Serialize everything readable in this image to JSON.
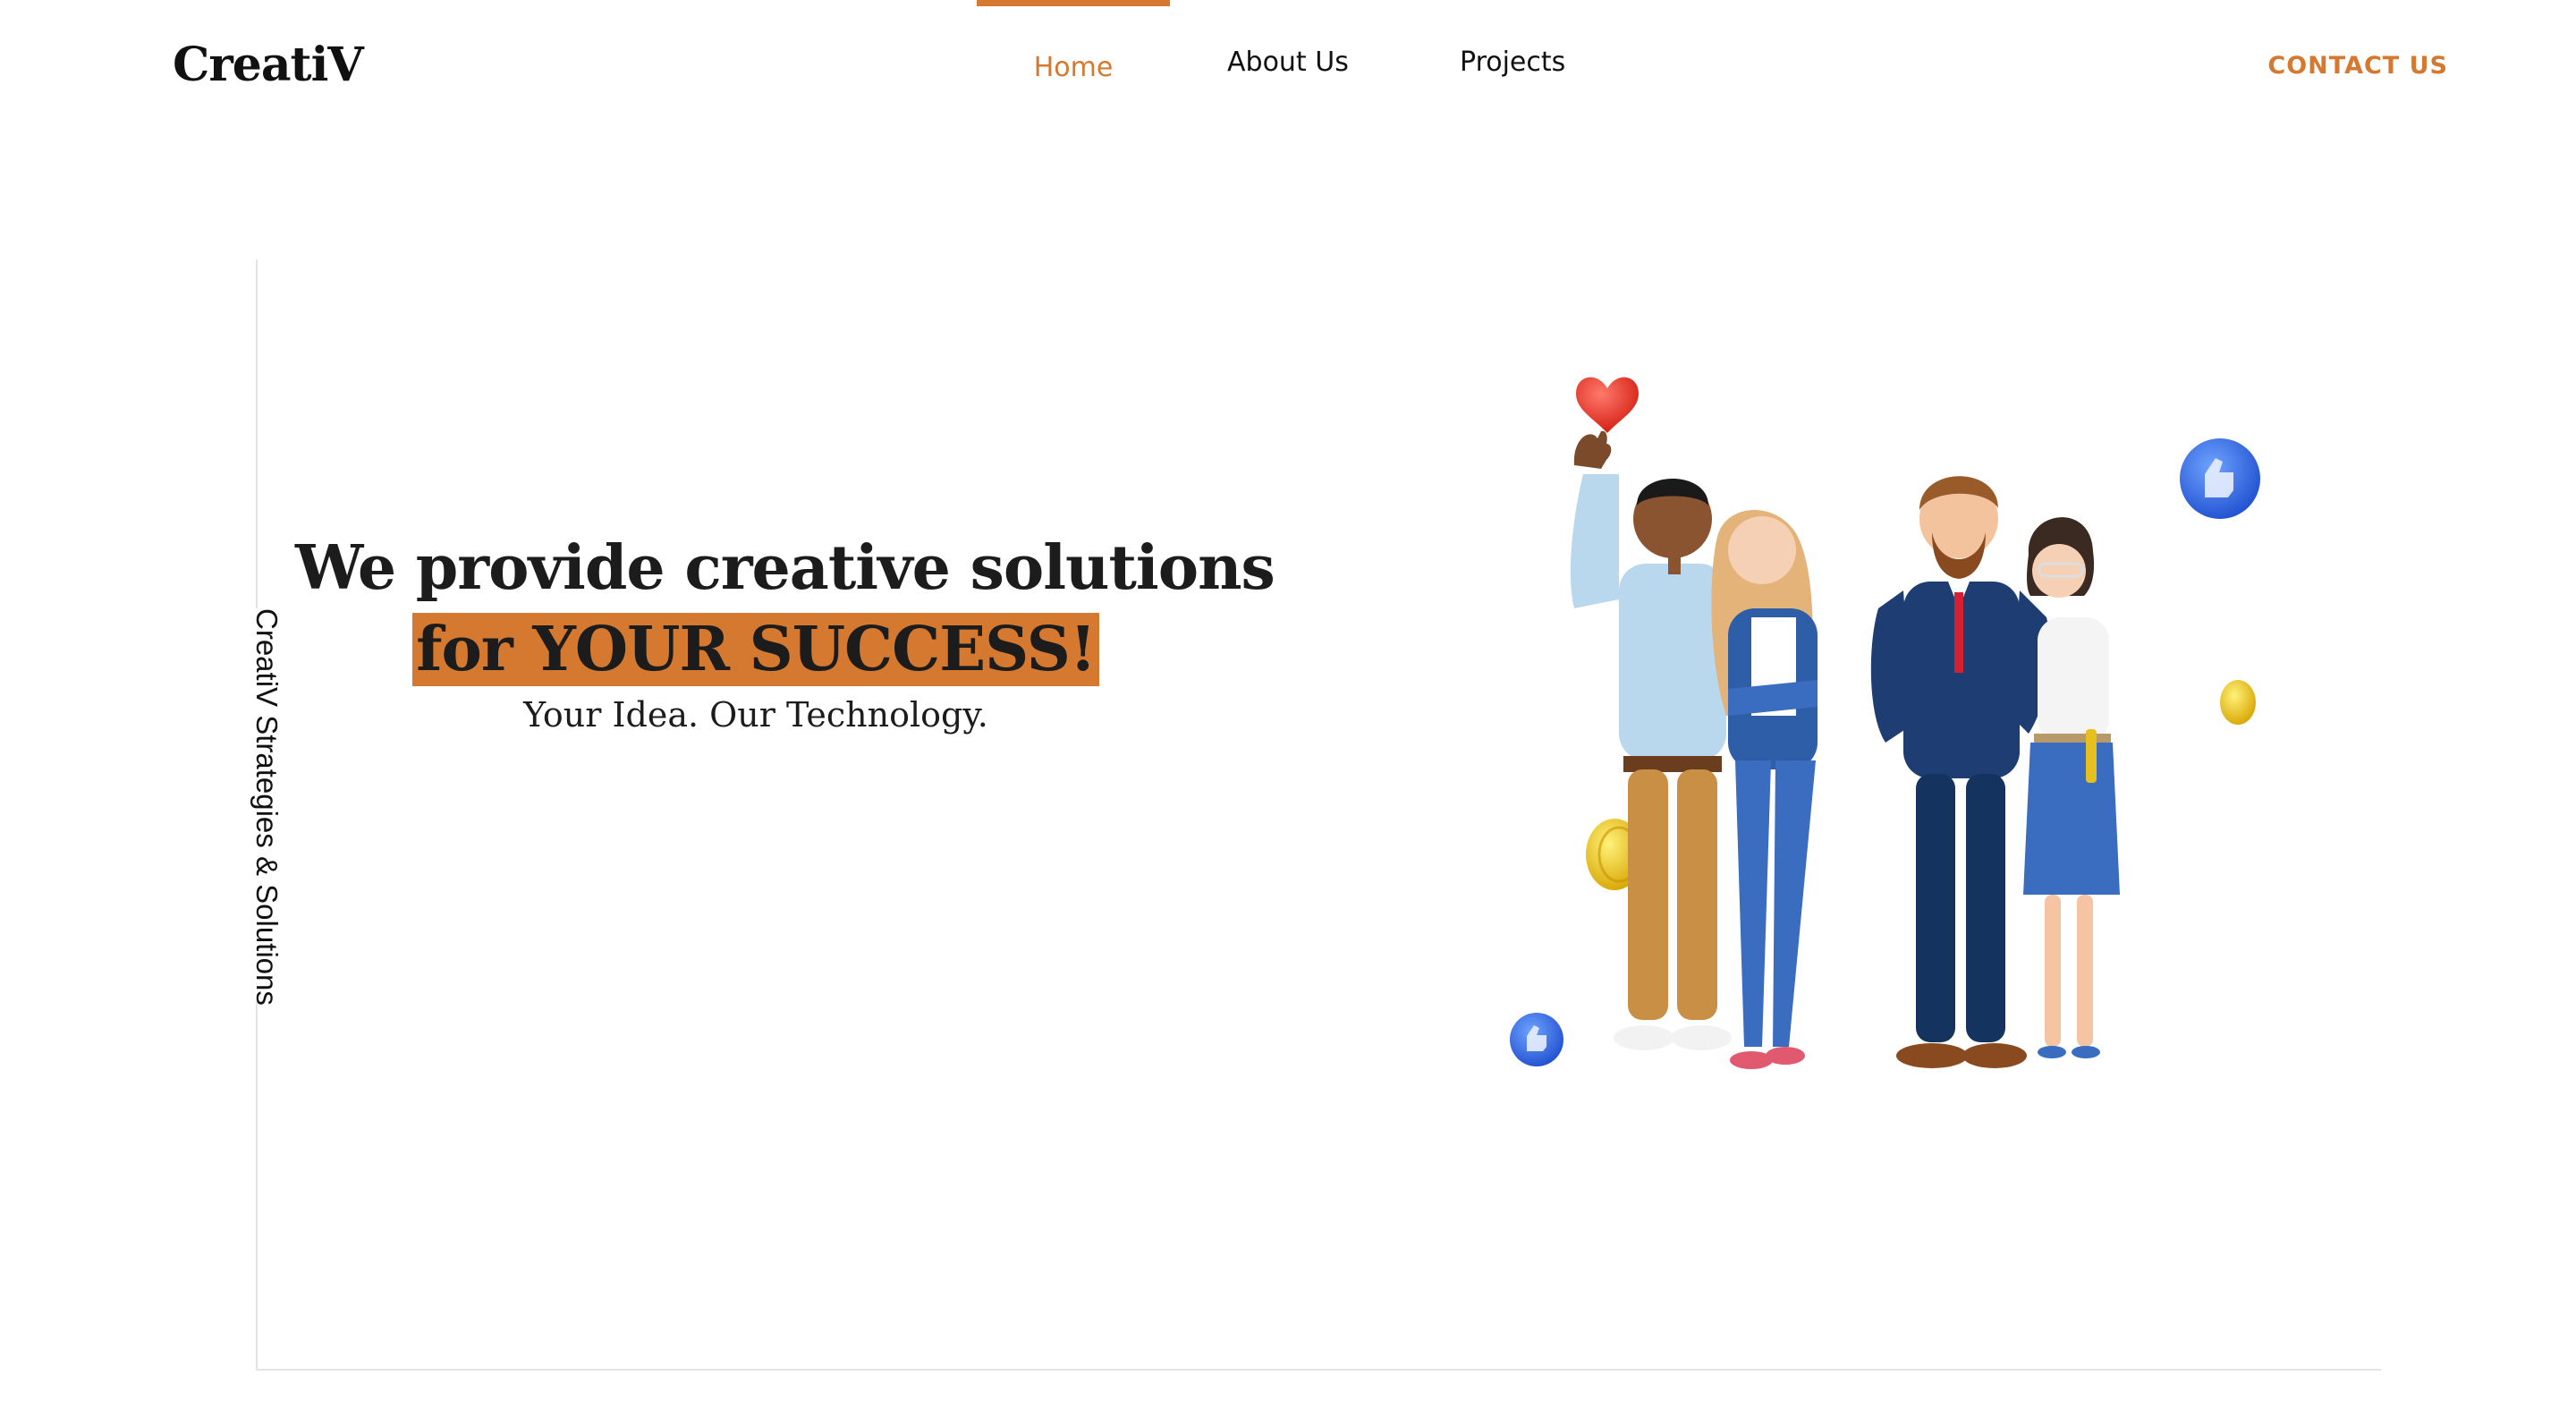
{
  "header": {
    "logo": "CreatiV",
    "nav": [
      {
        "label": "Home",
        "active": true
      },
      {
        "label": "About Us",
        "active": false
      },
      {
        "label": "Projects",
        "active": false
      }
    ],
    "contact_label": "CONTACT US"
  },
  "side": {
    "vertical_text": "CreatiV Strategies & Solutions"
  },
  "hero": {
    "line1": "We provide creative solutions",
    "line2": "for YOUR SUCCESS!",
    "subtitle": "Your Idea. Our Technology."
  },
  "colors": {
    "accent": "#d4792f",
    "text": "#111111",
    "frame": "#e4e4e4"
  },
  "icons": [
    "heart-icon",
    "thumbs-up-icon",
    "coin-icon"
  ]
}
